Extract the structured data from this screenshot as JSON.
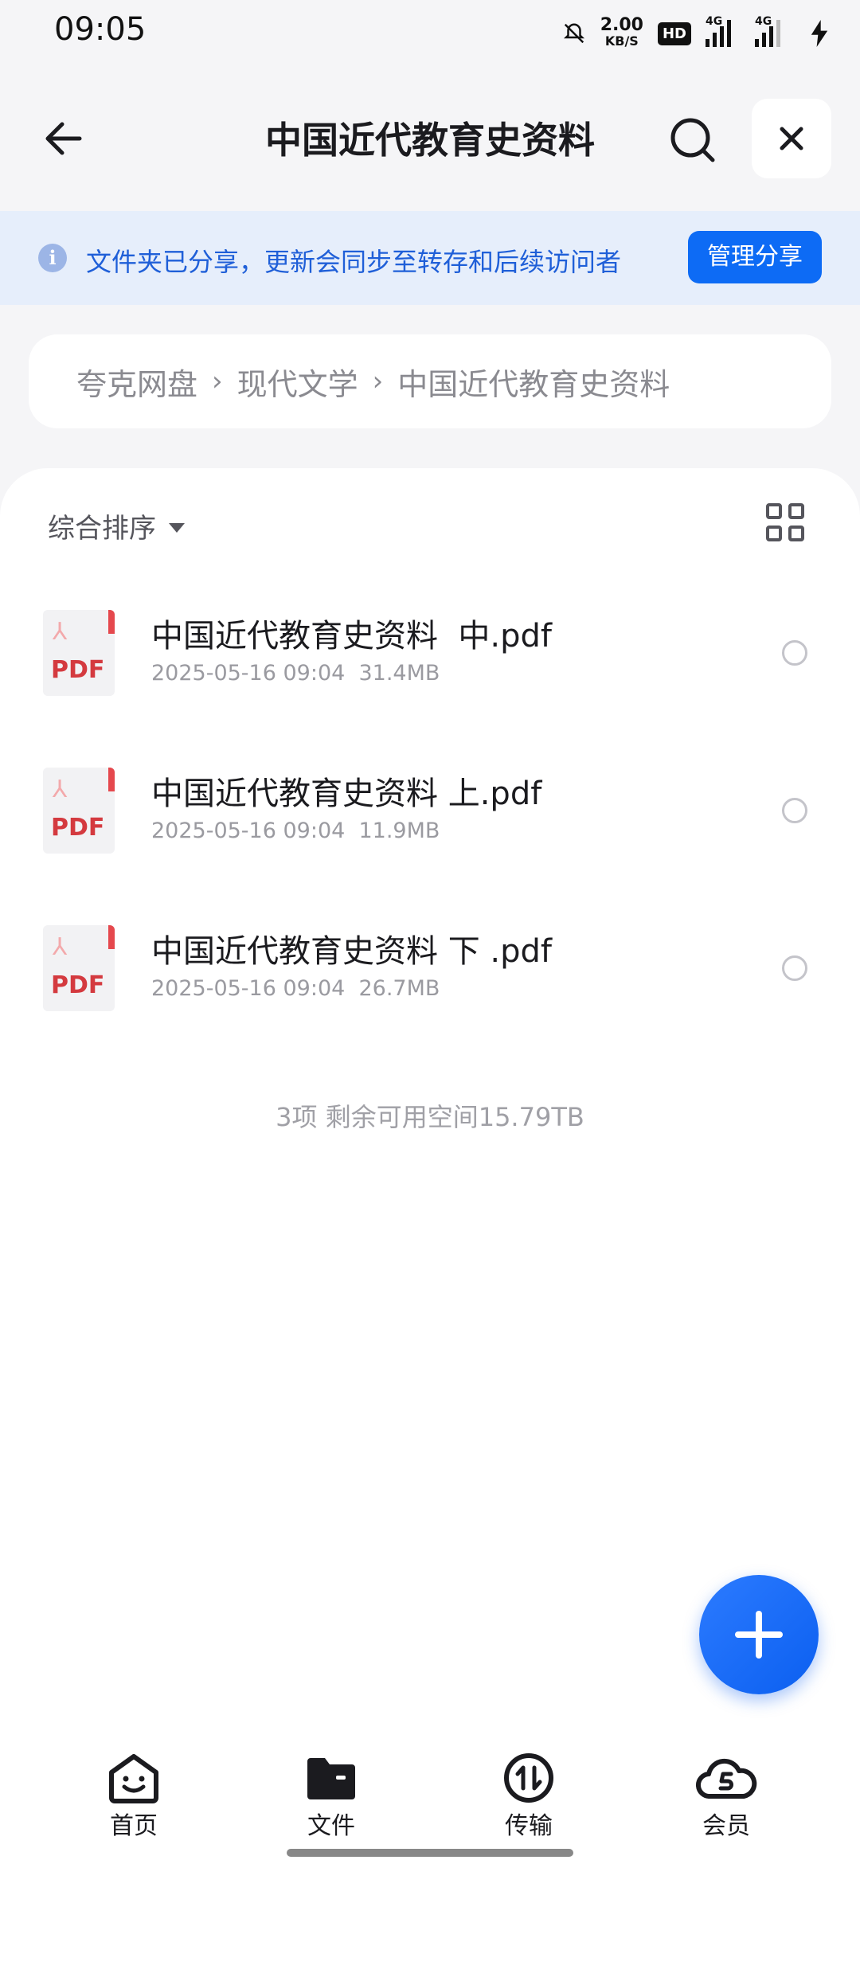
{
  "status_bar": {
    "time": "09:05",
    "speed_value": "2.00",
    "speed_unit": "KB/S",
    "hd_label": "HD",
    "network_1": "4G",
    "network_2": "4G"
  },
  "header": {
    "title": "中国近代教育史资料"
  },
  "banner": {
    "text": "文件夹已分享，更新会同步至转存和后续访问者",
    "button_label": "管理分享"
  },
  "breadcrumb": [
    "夸克网盘",
    "现代文学",
    "中国近代教育史资料"
  ],
  "toolbar": {
    "sort_label": "综合排序"
  },
  "files": [
    {
      "name": "中国近代教育史资料  中.pdf",
      "date": "2025-05-16 09:04",
      "size": "31.4MB",
      "icon_text": "PDF"
    },
    {
      "name": "中国近代教育史资料 上.pdf",
      "date": "2025-05-16 09:04",
      "size": "11.9MB",
      "icon_text": "PDF"
    },
    {
      "name": "中国近代教育史资料 下 .pdf",
      "date": "2025-05-16 09:04",
      "size": "26.7MB",
      "icon_text": "PDF"
    }
  ],
  "summary": "3项 剩余可用空间15.79TB",
  "bottom_nav": [
    {
      "label": "首页",
      "icon": "home-face-icon"
    },
    {
      "label": "文件",
      "icon": "folder-icon"
    },
    {
      "label": "传输",
      "icon": "transfer-icon"
    },
    {
      "label": "会员",
      "icon": "member-cloud-icon"
    }
  ],
  "colors": {
    "accent": "#0D6BF5",
    "banner_bg": "#E6EEFB",
    "banner_text": "#1F5FD8",
    "pdf_red": "#D43A3F"
  }
}
